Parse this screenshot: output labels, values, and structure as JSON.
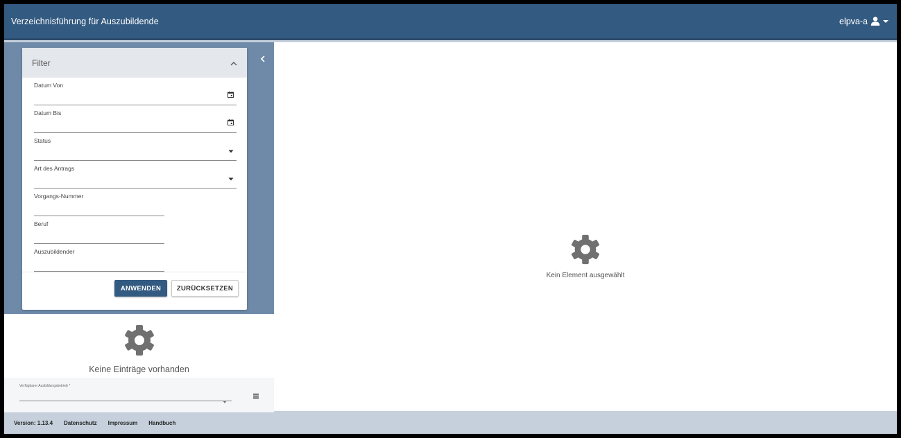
{
  "header": {
    "title": "Verzeichnisführung für Auszubildende",
    "username": "elpva-a"
  },
  "filter": {
    "title": "Filter",
    "fields": [
      {
        "label": "Datum Von",
        "value": "",
        "type": "date"
      },
      {
        "label": "Datum Bis",
        "value": "",
        "type": "date"
      },
      {
        "label": "Status",
        "value": "",
        "type": "select"
      },
      {
        "label": "Art des Antrags",
        "value": "",
        "type": "select"
      },
      {
        "label": "Vorgangs-Nummer",
        "value": "",
        "type": "text"
      },
      {
        "label": "Beruf",
        "value": "",
        "type": "text"
      },
      {
        "label": "Auszubildender",
        "value": "",
        "type": "text"
      }
    ],
    "apply_label": "ANWENDEN",
    "reset_label": "ZURÜCKSETZEN"
  },
  "list": {
    "empty_text": "Keine Einträge vorhanden"
  },
  "company_select": {
    "label": "Verfügbarer Ausbildungsbetrieb *",
    "value": ""
  },
  "footer": {
    "version": "Version: 1.13.4",
    "links": [
      "Datenschutz",
      "Impressum",
      "Handbuch"
    ]
  },
  "detail": {
    "empty_text": "Kein Element ausgewählt"
  },
  "colors": {
    "primary": "#335a80",
    "sidebar": "#6e8aa8",
    "background": "#c5d0dc"
  },
  "icons": [
    "user-icon",
    "caret-down-icon",
    "chevron-left-icon",
    "chevron-up-icon",
    "calendar-icon",
    "gear-icon",
    "menu-icon"
  ]
}
